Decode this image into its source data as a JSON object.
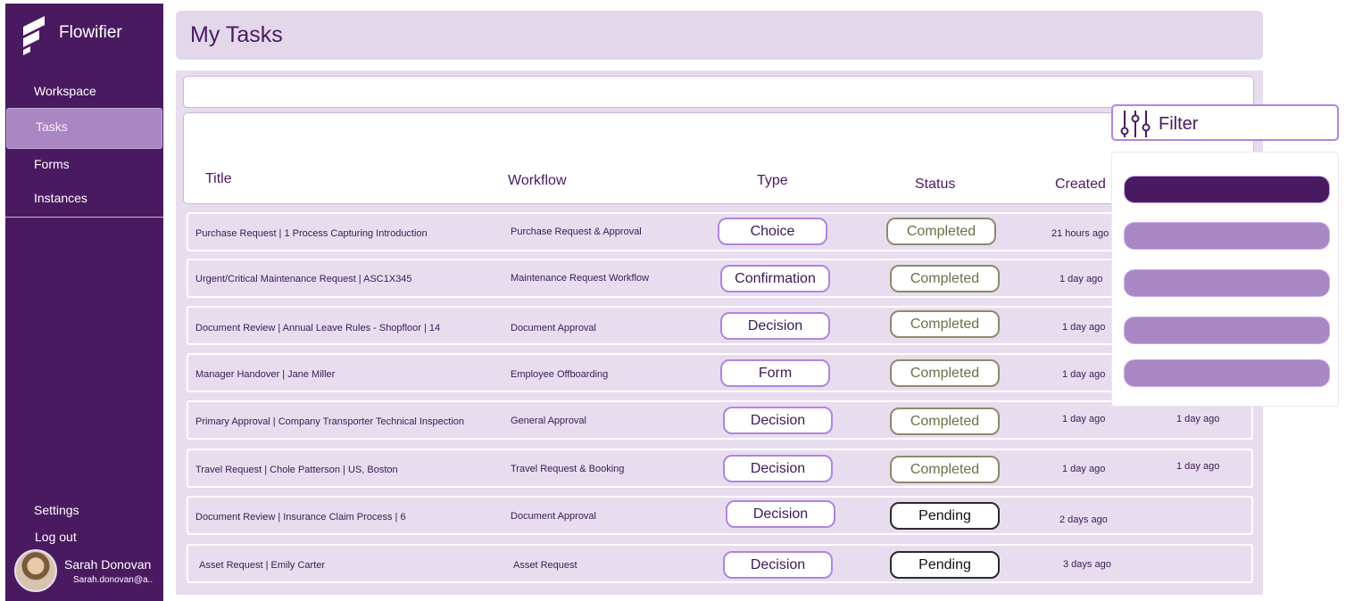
{
  "app": {
    "name": "Flowifier",
    "page_title": "My Tasks"
  },
  "sidebar": {
    "items": [
      {
        "label": "Workspace"
      },
      {
        "label": "Tasks"
      },
      {
        "label": "Forms"
      },
      {
        "label": "Instances"
      }
    ],
    "settings_label": "Settings",
    "logout_label": "Log out",
    "user": {
      "name": "Sarah Donovan",
      "email": "Sarah.donovan@a.."
    }
  },
  "search": {
    "placeholder": ""
  },
  "table": {
    "headers": {
      "title": "Title",
      "workflow": "Workflow",
      "type": "Type",
      "status": "Status",
      "created": "Created"
    },
    "rows": [
      {
        "title": "Purchase Request | 1 Process Capturing Introduction",
        "workflow": "Purchase Request & Approval",
        "type": "Choice",
        "status": "Completed",
        "created": "21 hours ago",
        "updated": ""
      },
      {
        "title": "Urgent/Critical Maintenance Request | ASC1X345",
        "workflow": "Maintenance Request Workflow",
        "type": "Confirmation",
        "status": "Completed",
        "created": "1 day ago",
        "updated": ""
      },
      {
        "title": "Document Review |  Annual Leave Rules - Shopfloor | 14",
        "workflow": "Document Approval",
        "type": "Decision",
        "status": "Completed",
        "created": "1 day ago",
        "updated": ""
      },
      {
        "title": "Manager Handover | Jane Miller",
        "workflow": "Employee Offboarding",
        "type": "Form",
        "status": "Completed",
        "created": "1 day ago",
        "updated": ""
      },
      {
        "title": "Primary Approval | Company Transporter Technical Inspection",
        "workflow": "General Approval",
        "type": "Decision",
        "status": "Completed",
        "created": "1 day ago",
        "updated": "1 day ago"
      },
      {
        "title": "Travel Request | Chole Patterson | US, Boston",
        "workflow": "Travel Request & Booking",
        "type": "Decision",
        "status": "Completed",
        "created": "1 day ago",
        "updated": "1 day ago"
      },
      {
        "title": "Document Review | Insurance Claim Process | 6",
        "workflow": "Document Approval",
        "type": "Decision",
        "status": "Pending",
        "created": "2 days ago",
        "updated": ""
      },
      {
        "title": "Asset Request | Emily Carter",
        "workflow": "Asset Request",
        "type": "Decision",
        "status": "Pending",
        "created": "3 days ago",
        "updated": ""
      }
    ]
  },
  "filter": {
    "label": "Filter",
    "options": [
      {
        "selected": true
      },
      {
        "selected": false
      },
      {
        "selected": false
      },
      {
        "selected": false
      },
      {
        "selected": false
      }
    ]
  },
  "colors": {
    "sidebar": "#4a1a60",
    "accent": "#a987c3",
    "panel": "#e8ddee",
    "completed_border": "#8d8a6e",
    "pending_border": "#2a2a2a",
    "type_border": "#b184e0"
  }
}
